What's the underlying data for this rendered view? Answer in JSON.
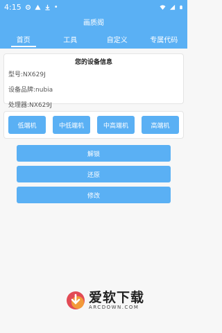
{
  "statusbar": {
    "time": "4:15"
  },
  "appbar": {
    "title": "画质阁"
  },
  "tabs": [
    {
      "label": "首页"
    },
    {
      "label": "工具"
    },
    {
      "label": "自定义"
    },
    {
      "label": "专属代码"
    }
  ],
  "device_info": {
    "title": "您的设备信息",
    "model": "型号:NX629J",
    "brand": "设备品牌:nubia",
    "processor": "处理器:NX629J"
  },
  "tiers": {
    "low": "低端机",
    "mid_low": "中低端机",
    "mid_high": "中高端机",
    "high": "高端机"
  },
  "actions": {
    "unlock": "解锁",
    "restore": "还原",
    "modify": "修改"
  },
  "watermark": {
    "main": "爱软下载",
    "sub": "ARCDOWN.COM"
  },
  "colors": {
    "accent": "#5ab0f4"
  }
}
